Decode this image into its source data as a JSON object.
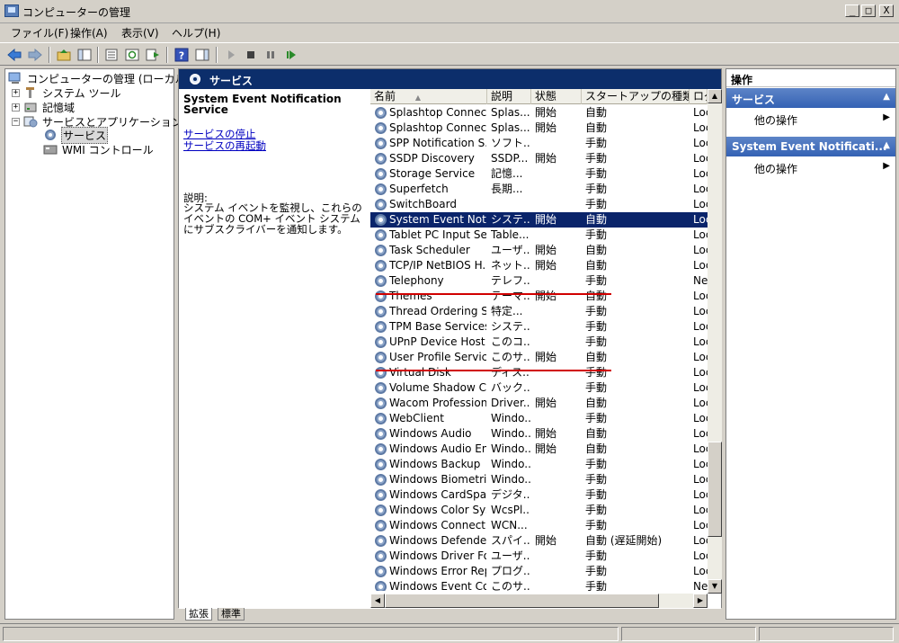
{
  "window": {
    "title": "コンピューターの管理",
    "min": "_",
    "max": "□",
    "close": "X"
  },
  "menu": [
    "ファイル(F)",
    "操作(A)",
    "表示(V)",
    "ヘルプ(H)"
  ],
  "tree": {
    "root": "コンピューターの管理 (ローカル)",
    "system_tools": "システム ツール",
    "storage": "記憶域",
    "services_apps": "サービスとアプリケーション",
    "services": "サービス",
    "wmi": "WMI コントロール"
  },
  "center": {
    "header": "サービス",
    "desc_title": "System Event Notification Service",
    "link_stop": "サービスの停止",
    "link_restart": "サービスの再起動",
    "desc_label": "説明:",
    "desc_text": "システム イベントを監視し、これらのイベントの COM+ イベント システムにサブスクライバーを通知します。"
  },
  "columns": [
    "名前",
    "説明",
    "状態",
    "スタートアップの種類",
    "ログ"
  ],
  "services": [
    {
      "name": "Splashtop Connect ...",
      "desc": "Splas...",
      "status": "開始",
      "startup": "自動",
      "logon": "Loc"
    },
    {
      "name": "Splashtop Connect ...",
      "desc": "Splas...",
      "status": "開始",
      "startup": "自動",
      "logon": "Loc"
    },
    {
      "name": "SPP Notification S...",
      "desc": "ソフト...",
      "status": "",
      "startup": "手動",
      "logon": "Loc"
    },
    {
      "name": "SSDP Discovery",
      "desc": "SSDP...",
      "status": "開始",
      "startup": "手動",
      "logon": "Loc"
    },
    {
      "name": "Storage Service",
      "desc": "記憶...",
      "status": "",
      "startup": "手動",
      "logon": "Loc"
    },
    {
      "name": "Superfetch",
      "desc": "長期...",
      "status": "",
      "startup": "手動",
      "logon": "Loc"
    },
    {
      "name": "SwitchBoard",
      "desc": "",
      "status": "",
      "startup": "手動",
      "logon": "Loc"
    },
    {
      "name": "System Event Notif...",
      "desc": "システ...",
      "status": "開始",
      "startup": "自動",
      "logon": "Loc"
    },
    {
      "name": "Tablet PC Input Se...",
      "desc": "Table...",
      "status": "",
      "startup": "手動",
      "logon": "Loc"
    },
    {
      "name": "Task Scheduler",
      "desc": "ユーザ...",
      "status": "開始",
      "startup": "自動",
      "logon": "Loc"
    },
    {
      "name": "TCP/IP NetBIOS H...",
      "desc": "ネット...",
      "status": "開始",
      "startup": "自動",
      "logon": "Loc"
    },
    {
      "name": "Telephony",
      "desc": "テレフ...",
      "status": "",
      "startup": "手動",
      "logon": "Ne"
    },
    {
      "name": "Themes",
      "desc": "テーマ...",
      "status": "開始",
      "startup": "自動",
      "logon": "Loc"
    },
    {
      "name": "Thread Ordering Se...",
      "desc": "特定...",
      "status": "",
      "startup": "手動",
      "logon": "Loc"
    },
    {
      "name": "TPM Base Services",
      "desc": "システ...",
      "status": "",
      "startup": "手動",
      "logon": "Loc"
    },
    {
      "name": "UPnP Device Host",
      "desc": "このコ...",
      "status": "",
      "startup": "手動",
      "logon": "Loc"
    },
    {
      "name": "User Profile Service",
      "desc": "このサ...",
      "status": "開始",
      "startup": "自動",
      "logon": "Loc"
    },
    {
      "name": "Virtual Disk",
      "desc": "ディス...",
      "status": "",
      "startup": "手動",
      "logon": "Loc"
    },
    {
      "name": "Volume Shadow Co...",
      "desc": "バック...",
      "status": "",
      "startup": "手動",
      "logon": "Loc"
    },
    {
      "name": "Wacom Professiona...",
      "desc": "Driver...",
      "status": "開始",
      "startup": "自動",
      "logon": "Loc"
    },
    {
      "name": "WebClient",
      "desc": "Windo...",
      "status": "",
      "startup": "手動",
      "logon": "Loc"
    },
    {
      "name": "Windows Audio",
      "desc": "Windo...",
      "status": "開始",
      "startup": "自動",
      "logon": "Loc"
    },
    {
      "name": "Windows Audio End...",
      "desc": "Windo...",
      "status": "開始",
      "startup": "自動",
      "logon": "Loc"
    },
    {
      "name": "Windows Backup",
      "desc": "Windo...",
      "status": "",
      "startup": "手動",
      "logon": "Loc"
    },
    {
      "name": "Windows Biometric...",
      "desc": "Windo...",
      "status": "",
      "startup": "手動",
      "logon": "Loc"
    },
    {
      "name": "Windows CardSpace",
      "desc": "デジタ...",
      "status": "",
      "startup": "手動",
      "logon": "Loc"
    },
    {
      "name": "Windows Color Sys...",
      "desc": "WcsPl...",
      "status": "",
      "startup": "手動",
      "logon": "Loc"
    },
    {
      "name": "Windows Connect ...",
      "desc": "WCN...",
      "status": "",
      "startup": "手動",
      "logon": "Loc"
    },
    {
      "name": "Windows Defender",
      "desc": "スパイ...",
      "status": "開始",
      "startup": "自動 (遅延開始)",
      "logon": "Loc"
    },
    {
      "name": "Windows Driver Fo...",
      "desc": "ユーザ...",
      "status": "",
      "startup": "手動",
      "logon": "Loc"
    },
    {
      "name": "Windows Error Rep...",
      "desc": "プログ...",
      "status": "",
      "startup": "手動",
      "logon": "Loc"
    },
    {
      "name": "Windows Event Col...",
      "desc": "このサ...",
      "status": "",
      "startup": "手動",
      "logon": "Ne"
    }
  ],
  "selected_service": "System Event Notif...",
  "tabs": {
    "extended": "拡張",
    "standard": "標準"
  },
  "actions": {
    "title": "操作",
    "section1": "サービス",
    "section1_item": "他の操作",
    "section2": "System Event Notificati...",
    "section2_item": "他の操作"
  },
  "icons": [
    "back-arrow-icon",
    "forward-arrow-icon",
    "up-folder-icon",
    "show-tree-icon",
    "properties-icon",
    "refresh-icon",
    "export-icon",
    "help-icon",
    "action-pane-icon",
    "play-icon",
    "stop-icon",
    "pause-icon",
    "restart-icon",
    "gear-icon"
  ],
  "colors": {
    "selection": "#0a246a",
    "header_bg": "#0c2e6b",
    "action_section": "#3462b4",
    "annotation_red": "#d00000"
  }
}
